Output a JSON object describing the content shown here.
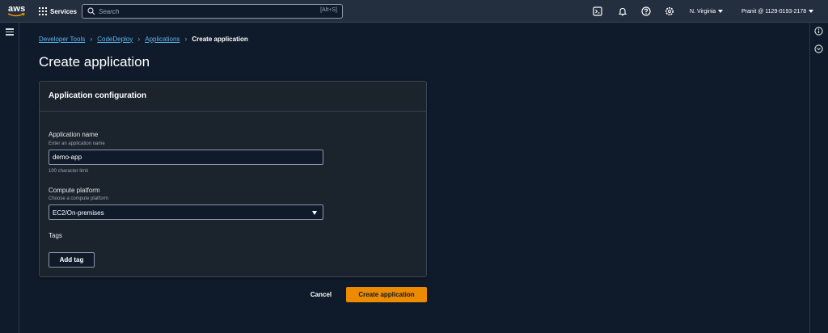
{
  "topnav": {
    "logo_text": "aws",
    "services_label": "Services",
    "search_placeholder": "Search",
    "search_shortcut": "[Alt+S]",
    "region": "N. Virginia",
    "account": "Pranit @ 1129-0193-2178",
    "icons": [
      "cloudshell-icon",
      "bell-icon",
      "help-icon",
      "settings-icon"
    ]
  },
  "breadcrumb": {
    "items": [
      "Developer Tools",
      "CodeDeploy",
      "Applications"
    ],
    "current": "Create application"
  },
  "page": {
    "title": "Create application"
  },
  "panel": {
    "header": "Application configuration",
    "app_name": {
      "label": "Application name",
      "description": "Enter an application name",
      "value": "demo-app",
      "constraint": "100 character limit"
    },
    "compute_platform": {
      "label": "Compute platform",
      "description": "Choose a compute platform",
      "value": "EC2/On-premises"
    },
    "tags": {
      "label": "Tags",
      "add_button": "Add tag"
    }
  },
  "actions": {
    "cancel": "Cancel",
    "submit": "Create application"
  },
  "colors": {
    "primary": "#ec8b00",
    "link": "#5fb3f0",
    "background": "#0f1b2a",
    "nav": "#232f3e"
  }
}
